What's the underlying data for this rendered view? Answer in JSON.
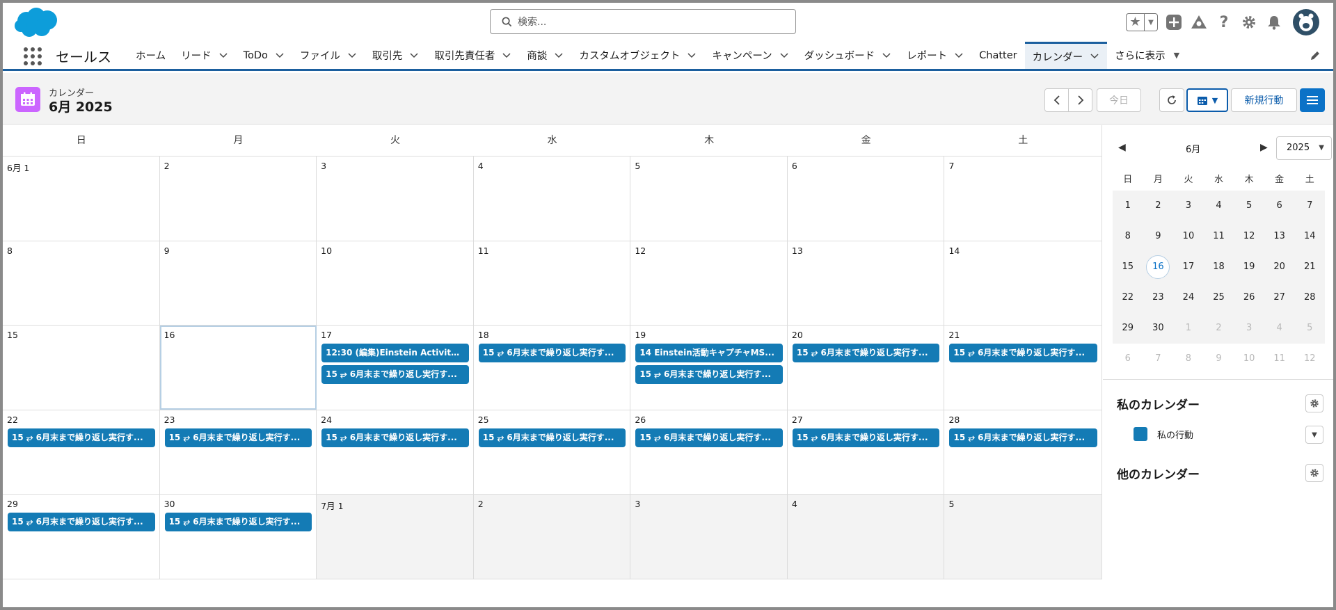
{
  "header": {
    "search_placeholder": "検索..."
  },
  "nav": {
    "app_name": "セールス",
    "tabs": [
      {
        "label": "ホーム",
        "chevron": false
      },
      {
        "label": "リード",
        "chevron": true
      },
      {
        "label": "ToDo",
        "chevron": true
      },
      {
        "label": "ファイル",
        "chevron": true
      },
      {
        "label": "取引先",
        "chevron": true
      },
      {
        "label": "取引先責任者",
        "chevron": true
      },
      {
        "label": "商談",
        "chevron": true
      },
      {
        "label": "カスタムオブジェクト",
        "chevron": true
      },
      {
        "label": "キャンペーン",
        "chevron": true
      },
      {
        "label": "ダッシュボード",
        "chevron": true
      },
      {
        "label": "レポート",
        "chevron": true
      },
      {
        "label": "Chatter",
        "chevron": false
      },
      {
        "label": "カレンダー",
        "chevron": true,
        "active": true
      }
    ],
    "more_label": "さらに表示"
  },
  "page": {
    "category": "カレンダー",
    "title": "6月 2025",
    "today_label": "今日",
    "new_event_label": "新規行動"
  },
  "calendar": {
    "weekdays": [
      "日",
      "月",
      "火",
      "水",
      "木",
      "金",
      "土"
    ],
    "weeks": [
      [
        {
          "d": "6月 1",
          "ev": []
        },
        {
          "d": "2",
          "ev": []
        },
        {
          "d": "3",
          "ev": []
        },
        {
          "d": "4",
          "ev": []
        },
        {
          "d": "5",
          "ev": []
        },
        {
          "d": "6",
          "ev": []
        },
        {
          "d": "7",
          "ev": []
        }
      ],
      [
        {
          "d": "8",
          "ev": []
        },
        {
          "d": "9",
          "ev": []
        },
        {
          "d": "10",
          "ev": []
        },
        {
          "d": "11",
          "ev": []
        },
        {
          "d": "12",
          "ev": []
        },
        {
          "d": "13",
          "ev": []
        },
        {
          "d": "14",
          "ev": []
        }
      ],
      [
        {
          "d": "15",
          "ev": []
        },
        {
          "d": "16",
          "ev": [],
          "today": true
        },
        {
          "d": "17",
          "ev": [
            "12:30 (編集)Einstein Activity C...",
            "15 ⥂ 6月末まで繰り返し実行す..."
          ]
        },
        {
          "d": "18",
          "ev": [
            "15 ⥂ 6月末まで繰り返し実行す..."
          ]
        },
        {
          "d": "19",
          "ev": [
            "14 Einstein活動キャプチャMS...",
            "15 ⥂ 6月末まで繰り返し実行す..."
          ]
        },
        {
          "d": "20",
          "ev": [
            "15 ⥂ 6月末まで繰り返し実行す..."
          ]
        },
        {
          "d": "21",
          "ev": [
            "15 ⥂ 6月末まで繰り返し実行す..."
          ]
        }
      ],
      [
        {
          "d": "22",
          "ev": [
            "15 ⥂ 6月末まで繰り返し実行す..."
          ]
        },
        {
          "d": "23",
          "ev": [
            "15 ⥂ 6月末まで繰り返し実行す..."
          ]
        },
        {
          "d": "24",
          "ev": [
            "15 ⥂ 6月末まで繰り返し実行す..."
          ]
        },
        {
          "d": "25",
          "ev": [
            "15 ⥂ 6月末まで繰り返し実行す..."
          ]
        },
        {
          "d": "26",
          "ev": [
            "15 ⥂ 6月末まで繰り返し実行す..."
          ]
        },
        {
          "d": "27",
          "ev": [
            "15 ⥂ 6月末まで繰り返し実行す..."
          ]
        },
        {
          "d": "28",
          "ev": [
            "15 ⥂ 6月末まで繰り返し実行す..."
          ]
        }
      ],
      [
        {
          "d": "29",
          "ev": [
            "15 ⥂ 6月末まで繰り返し実行す..."
          ]
        },
        {
          "d": "30",
          "ev": [
            "15 ⥂ 6月末まで繰り返し実行す..."
          ]
        },
        {
          "d": "7月 1",
          "ev": [],
          "other": true
        },
        {
          "d": "2",
          "ev": [],
          "other": true
        },
        {
          "d": "3",
          "ev": [],
          "other": true
        },
        {
          "d": "4",
          "ev": [],
          "other": true
        },
        {
          "d": "5",
          "ev": [],
          "other": true
        }
      ]
    ]
  },
  "mini_calendar": {
    "month": "6月",
    "year": "2025",
    "weekdays": [
      "日",
      "月",
      "火",
      "水",
      "木",
      "金",
      "土"
    ],
    "rows": [
      [
        "1",
        "2",
        "3",
        "4",
        "5",
        "6",
        "7"
      ],
      [
        "8",
        "9",
        "10",
        "11",
        "12",
        "13",
        "14"
      ],
      [
        "15",
        "16",
        "17",
        "18",
        "19",
        "20",
        "21"
      ],
      [
        "22",
        "23",
        "24",
        "25",
        "26",
        "27",
        "28"
      ],
      [
        "29",
        "30",
        "1",
        "2",
        "3",
        "4",
        "5"
      ],
      [
        "6",
        "7",
        "8",
        "9",
        "10",
        "11",
        "12"
      ]
    ],
    "selected": "16"
  },
  "sidebar": {
    "my_calendars_title": "私のカレンダー",
    "my_calendar_item": "私の行動",
    "other_calendars_title": "他のカレンダー"
  },
  "colors": {
    "brand": "#0b72c7",
    "event": "#147bb5",
    "calendar_icon": "#cb65ff"
  }
}
